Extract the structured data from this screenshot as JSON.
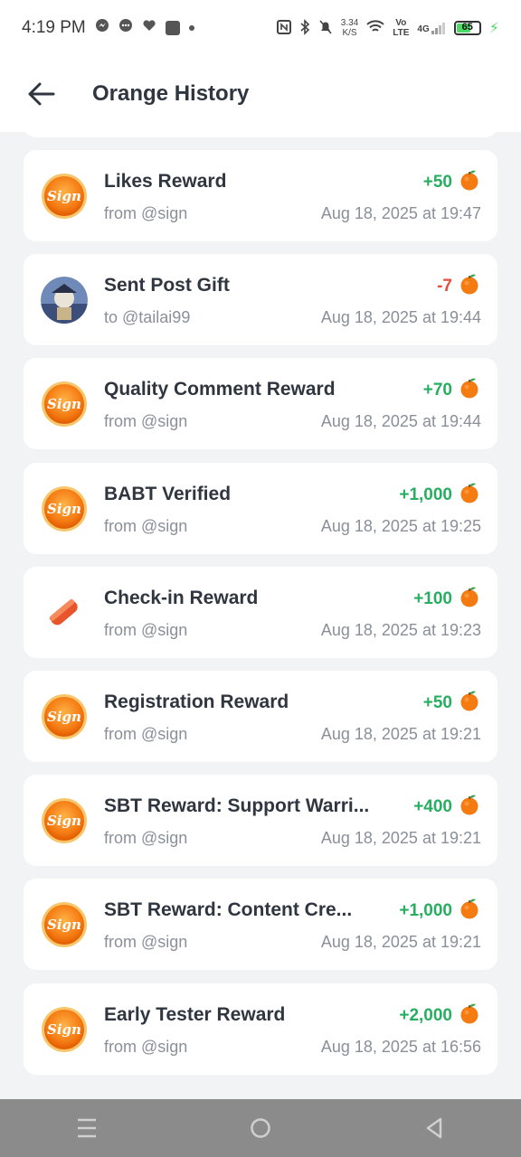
{
  "status_bar": {
    "time": "4:19 PM",
    "net_speed_value": "3.34",
    "net_speed_unit": "K/S",
    "volte": "Vo\nLTE",
    "signal": "4G",
    "battery": "65"
  },
  "header": {
    "title": "Orange History"
  },
  "items": [
    {
      "title": "Likes Reward",
      "sub": "from @sign",
      "amount": "+50",
      "date": "Aug 18, 2025 at 19:47",
      "kind": "sign",
      "sign": "positive"
    },
    {
      "title": "Sent Post Gift",
      "sub": "to @tailai99",
      "amount": "-7",
      "date": "Aug 18, 2025 at 19:44",
      "kind": "user",
      "sign": "negative"
    },
    {
      "title": "Quality Comment Reward",
      "sub": "from @sign",
      "amount": "+70",
      "date": "Aug 18, 2025 at 19:44",
      "kind": "sign",
      "sign": "positive"
    },
    {
      "title": "BABT Verified",
      "sub": "from @sign",
      "amount": "+1,000",
      "date": "Aug 18, 2025 at 19:25",
      "kind": "sign",
      "sign": "positive"
    },
    {
      "title": "Check-in Reward",
      "sub": "from @sign",
      "amount": "+100",
      "date": "Aug 18, 2025 at 19:23",
      "kind": "pill",
      "sign": "positive"
    },
    {
      "title": "Registration Reward",
      "sub": "from @sign",
      "amount": "+50",
      "date": "Aug 18, 2025 at 19:21",
      "kind": "sign",
      "sign": "positive"
    },
    {
      "title": "SBT Reward: Support Warri...",
      "sub": "from @sign",
      "amount": "+400",
      "date": "Aug 18, 2025 at 19:21",
      "kind": "sign",
      "sign": "positive"
    },
    {
      "title": "SBT Reward: Content Cre...",
      "sub": "from @sign",
      "amount": "+1,000",
      "date": "Aug 18, 2025 at 19:21",
      "kind": "sign",
      "sign": "positive"
    },
    {
      "title": "Early Tester Reward",
      "sub": "from @sign",
      "amount": "+2,000",
      "date": "Aug 18, 2025 at 16:56",
      "kind": "sign",
      "sign": "positive"
    }
  ],
  "colors": {
    "positive": "#27ae60",
    "negative": "#e74c3c",
    "accent_orange": "#f47a12"
  }
}
